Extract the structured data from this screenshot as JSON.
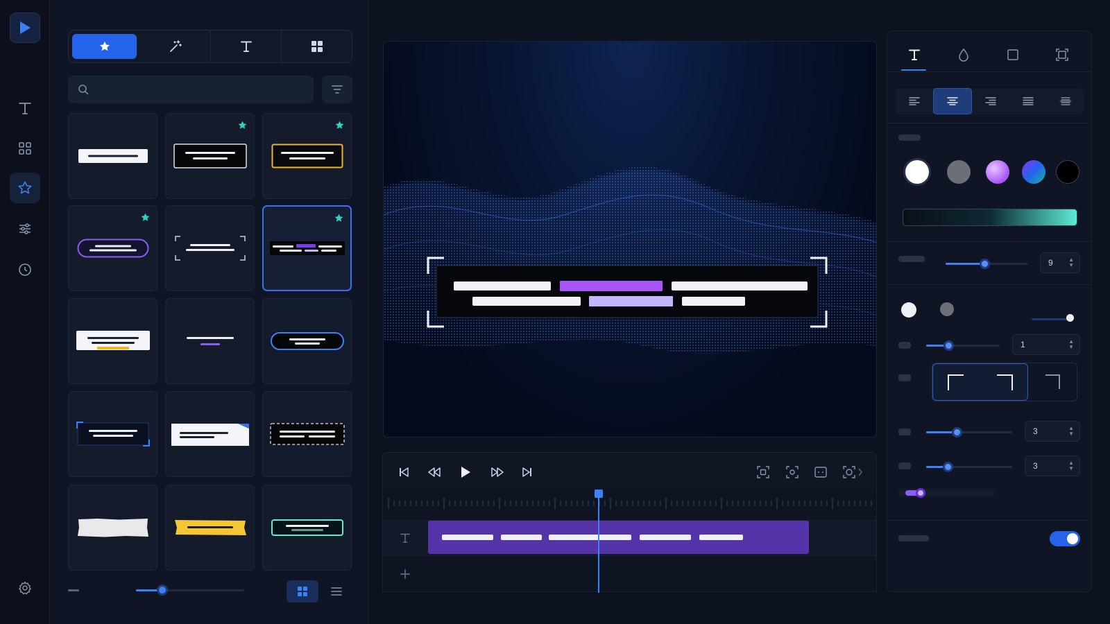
{
  "inspector": {
    "shadow_value": "9",
    "stroke_width_value": "1",
    "spacing_value": "3",
    "padding_value": "3"
  },
  "colors": {
    "accent": "#2563eb",
    "highlight_purple": "#a855f7",
    "teal_star": "#2dd4bf",
    "clip_purple": "#5533a8"
  },
  "icons": {
    "rail": [
      "play-logo-icon",
      "text-icon",
      "grid-icon",
      "star-icon",
      "sliders-icon",
      "clock-icon",
      "gear-icon"
    ],
    "library_tabs": [
      "star-icon",
      "magic-wand-icon",
      "text-icon",
      "grid-icon"
    ],
    "inspector_tabs": [
      "text-icon",
      "drop-icon",
      "square-icon",
      "crop-icon"
    ]
  }
}
